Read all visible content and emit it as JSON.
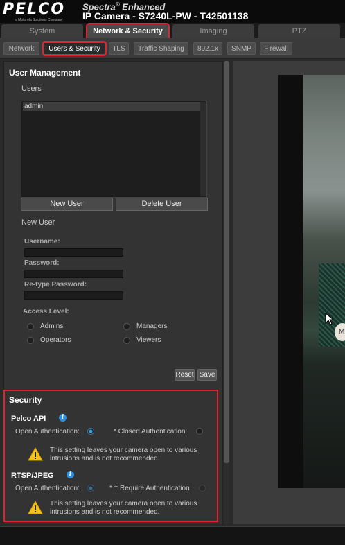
{
  "header": {
    "logo": "PELCO",
    "logo_sub": "a Motorola Solutions Company",
    "brand": "Spectra",
    "brand_mark": "®",
    "brand_suffix": "Enhanced",
    "title": "IP Camera - S7240L-PW - T42501138"
  },
  "main_tabs": [
    "System",
    "Network & Security",
    "Imaging",
    "PTZ"
  ],
  "sub_tabs": [
    "Network",
    "Users & Security",
    "TLS",
    "Traffic Shaping",
    "802.1x",
    "SNMP",
    "Firewall"
  ],
  "user_management": {
    "title": "User Management",
    "users_label": "Users",
    "users": [
      "admin"
    ],
    "new_user_button": "New User",
    "delete_user_button": "Delete User",
    "new_user_title": "New User",
    "username_label": "Username:",
    "password_label": "Password:",
    "retype_label": "Re-type Password:",
    "access_label": "Access Level:",
    "levels": [
      "Admins",
      "Managers",
      "Operators",
      "Viewers"
    ],
    "reset_button": "Reset",
    "save_button": "Save"
  },
  "security": {
    "title": "Security",
    "pelco_api": {
      "label": "Pelco API",
      "open_auth": "Open Authentication:",
      "closed_auth": "* Closed Authentication:",
      "selected": "open",
      "warning": "This setting leaves your camera open to various intrusions and is not recommended."
    },
    "rtsp": {
      "label": "RTSP/JPEG",
      "open_auth": "Open Authentication:",
      "require_auth": "* † Require Authentication",
      "selected": "open",
      "warning": "This setting leaves your camera open to various intrusions and is not recommended."
    }
  },
  "preview": {
    "bubble_text": "M"
  },
  "colors": {
    "highlight": "#e0232f",
    "accent": "#3ea7e6",
    "warning": "#f2c21a"
  }
}
